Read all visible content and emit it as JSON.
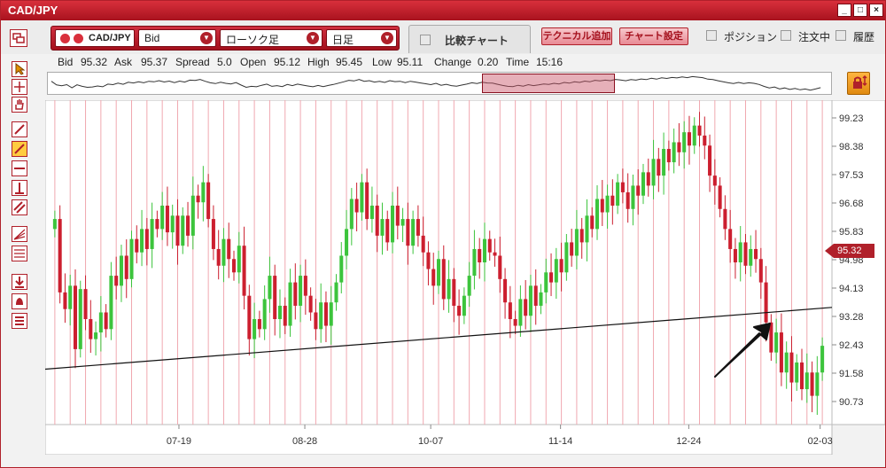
{
  "window": {
    "title": "CAD/JPY",
    "minimize": "_",
    "maximize": "□",
    "close": "×"
  },
  "toolbar": {
    "pair_label": "CAD/JPY",
    "price_type": "Bid",
    "chart_type": "ローソク足",
    "period": "日足",
    "compare_label": "比較チャート",
    "add_technical_label": "テクニカル追加",
    "chart_settings_label": "チャート設定",
    "position_label": "ポジション",
    "orders_label": "注文中",
    "history_label": "履歴"
  },
  "quote": {
    "bid_label": "Bid",
    "bid": "95.32",
    "ask_label": "Ask",
    "ask": "95.37",
    "spread_label": "Spread",
    "spread": "5.0",
    "open_label": "Open",
    "open": "95.12",
    "high_label": "High",
    "high": "95.45",
    "low_label": "Low",
    "low": "95.11",
    "change_label": "Change",
    "change": "0.20",
    "time_label": "Time",
    "time": "15:16"
  },
  "colors": {
    "accent": "#b0202a",
    "up": "#3cc43c",
    "down": "#cc1f2f",
    "grid": "#f0a8b0"
  },
  "current_price": "95.32",
  "chart_data": {
    "type": "candlestick",
    "y_ticks": [
      "99.23",
      "98.38",
      "97.53",
      "96.68",
      "95.83",
      "94.98",
      "94.13",
      "93.28",
      "92.43",
      "91.58",
      "90.73"
    ],
    "ylim": [
      90.73,
      99.23
    ],
    "x_ticks": [
      "07-19",
      "08-28",
      "10-07",
      "11-14",
      "12-24",
      "02-03"
    ],
    "series": [
      {
        "values": [
          96.2,
          94.0,
          93.5,
          94.2,
          92.3,
          94.1,
          93.2,
          92.6,
          92.8,
          93.4,
          92.9,
          94.5,
          94.2,
          95.1,
          94.4,
          95.6,
          95.2,
          95.9,
          95.3,
          96.2,
          95.9,
          96.6,
          95.8,
          96.3,
          95.4,
          96.3,
          95.7,
          96.9,
          96.7,
          97.3,
          96.2,
          95.3,
          94.8,
          95.6,
          95.0,
          94.6,
          95.4,
          93.9,
          92.6,
          93.2,
          92.9,
          93.8,
          94.5,
          93.2,
          93.6,
          93.0,
          94.3,
          93.6,
          94.5,
          93.9,
          93.4,
          92.9,
          93.7,
          93.0,
          93.7,
          94.3,
          95.1,
          95.9,
          96.8,
          96.4,
          97.3,
          96.2,
          96.6,
          95.7,
          96.2,
          95.5,
          96.6,
          96.0,
          96.2,
          95.4,
          96.2,
          95.7,
          95.2,
          94.7,
          94.2,
          95.0,
          93.8,
          94.4,
          93.6,
          93.3,
          93.9,
          94.5,
          95.3,
          94.9,
          95.6,
          95.2,
          95.1,
          94.4,
          93.7,
          93.2,
          93.0,
          93.8,
          93.3,
          94.2,
          93.6,
          94.0,
          94.6,
          94.3,
          95.0,
          94.6,
          95.5,
          95.1,
          95.9,
          95.5,
          96.3,
          95.9,
          96.8,
          96.4,
          96.9,
          96.6,
          97.3,
          97.0,
          96.5,
          97.2,
          96.9,
          97.6,
          97.2,
          98.0,
          97.5,
          98.3,
          97.9,
          98.5,
          98.2,
          98.8,
          98.4,
          99.0,
          98.7,
          98.4,
          97.5,
          97.2,
          96.5,
          95.9,
          95.3,
          94.9,
          95.5,
          94.8,
          95.3,
          95.0,
          94.3,
          93.1,
          92.2,
          92.8,
          91.6,
          92.2,
          91.3,
          91.9,
          91.1,
          91.6,
          90.9,
          91.6,
          92.4
        ]
      }
    ],
    "trendline": {
      "start": 91.7,
      "end": 93.55
    },
    "annotation": "arrow"
  }
}
